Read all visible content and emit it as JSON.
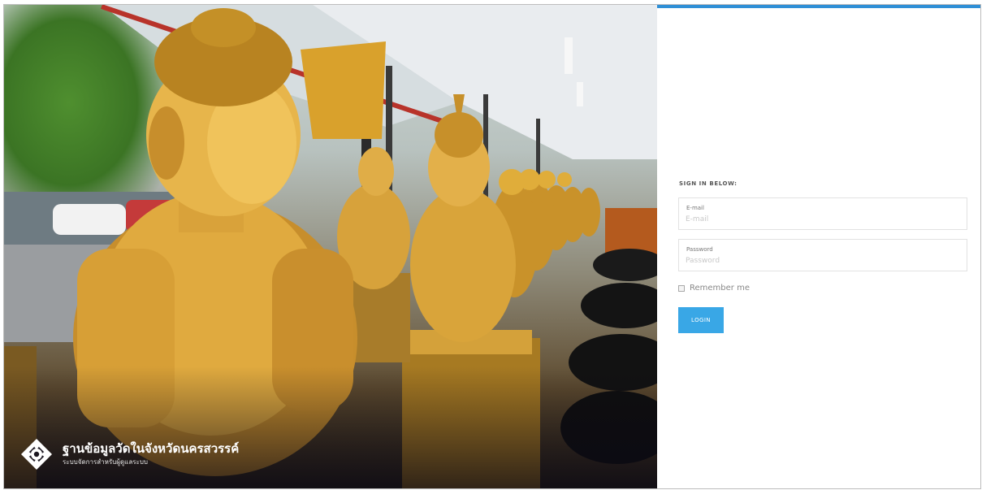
{
  "brand": {
    "title": "ฐานข้อมูลวัดในจังหวัดนครสวรรค์",
    "subtitle": "ระบบจัดการสำหรับผู้ดูแลระบบ",
    "logo_icon": "lotus-diamond-logo-icon"
  },
  "login": {
    "heading": "SIGN IN BELOW:",
    "email": {
      "label": "E-mail",
      "placeholder": "E-mail",
      "value": ""
    },
    "password": {
      "label": "Password",
      "placeholder": "Password",
      "value": ""
    },
    "remember_label": "Remember me",
    "remember_checked": false,
    "button_label": "LOGIN"
  },
  "colors": {
    "accent": "#39a7e6",
    "topbar": "#2f8fd6"
  }
}
